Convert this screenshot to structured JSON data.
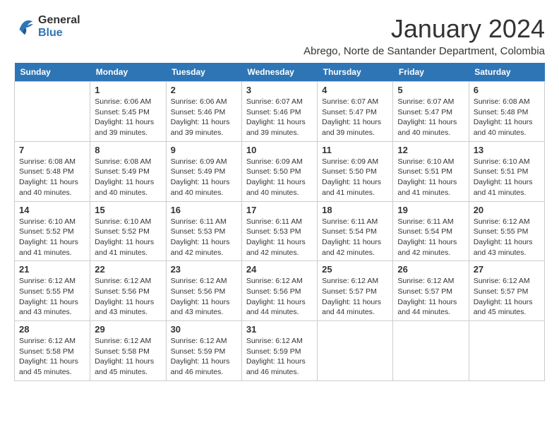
{
  "logo": {
    "text_general": "General",
    "text_blue": "Blue"
  },
  "header": {
    "title": "January 2024",
    "subtitle": "Abrego, Norte de Santander Department, Colombia"
  },
  "weekdays": [
    "Sunday",
    "Monday",
    "Tuesday",
    "Wednesday",
    "Thursday",
    "Friday",
    "Saturday"
  ],
  "weeks": [
    [
      {
        "day": "",
        "info": ""
      },
      {
        "day": "1",
        "info": "Sunrise: 6:06 AM\nSunset: 5:45 PM\nDaylight: 11 hours\nand 39 minutes."
      },
      {
        "day": "2",
        "info": "Sunrise: 6:06 AM\nSunset: 5:46 PM\nDaylight: 11 hours\nand 39 minutes."
      },
      {
        "day": "3",
        "info": "Sunrise: 6:07 AM\nSunset: 5:46 PM\nDaylight: 11 hours\nand 39 minutes."
      },
      {
        "day": "4",
        "info": "Sunrise: 6:07 AM\nSunset: 5:47 PM\nDaylight: 11 hours\nand 39 minutes."
      },
      {
        "day": "5",
        "info": "Sunrise: 6:07 AM\nSunset: 5:47 PM\nDaylight: 11 hours\nand 40 minutes."
      },
      {
        "day": "6",
        "info": "Sunrise: 6:08 AM\nSunset: 5:48 PM\nDaylight: 11 hours\nand 40 minutes."
      }
    ],
    [
      {
        "day": "7",
        "info": "Sunrise: 6:08 AM\nSunset: 5:48 PM\nDaylight: 11 hours\nand 40 minutes."
      },
      {
        "day": "8",
        "info": "Sunrise: 6:08 AM\nSunset: 5:49 PM\nDaylight: 11 hours\nand 40 minutes."
      },
      {
        "day": "9",
        "info": "Sunrise: 6:09 AM\nSunset: 5:49 PM\nDaylight: 11 hours\nand 40 minutes."
      },
      {
        "day": "10",
        "info": "Sunrise: 6:09 AM\nSunset: 5:50 PM\nDaylight: 11 hours\nand 40 minutes."
      },
      {
        "day": "11",
        "info": "Sunrise: 6:09 AM\nSunset: 5:50 PM\nDaylight: 11 hours\nand 41 minutes."
      },
      {
        "day": "12",
        "info": "Sunrise: 6:10 AM\nSunset: 5:51 PM\nDaylight: 11 hours\nand 41 minutes."
      },
      {
        "day": "13",
        "info": "Sunrise: 6:10 AM\nSunset: 5:51 PM\nDaylight: 11 hours\nand 41 minutes."
      }
    ],
    [
      {
        "day": "14",
        "info": "Sunrise: 6:10 AM\nSunset: 5:52 PM\nDaylight: 11 hours\nand 41 minutes."
      },
      {
        "day": "15",
        "info": "Sunrise: 6:10 AM\nSunset: 5:52 PM\nDaylight: 11 hours\nand 41 minutes."
      },
      {
        "day": "16",
        "info": "Sunrise: 6:11 AM\nSunset: 5:53 PM\nDaylight: 11 hours\nand 42 minutes."
      },
      {
        "day": "17",
        "info": "Sunrise: 6:11 AM\nSunset: 5:53 PM\nDaylight: 11 hours\nand 42 minutes."
      },
      {
        "day": "18",
        "info": "Sunrise: 6:11 AM\nSunset: 5:54 PM\nDaylight: 11 hours\nand 42 minutes."
      },
      {
        "day": "19",
        "info": "Sunrise: 6:11 AM\nSunset: 5:54 PM\nDaylight: 11 hours\nand 42 minutes."
      },
      {
        "day": "20",
        "info": "Sunrise: 6:12 AM\nSunset: 5:55 PM\nDaylight: 11 hours\nand 43 minutes."
      }
    ],
    [
      {
        "day": "21",
        "info": "Sunrise: 6:12 AM\nSunset: 5:55 PM\nDaylight: 11 hours\nand 43 minutes."
      },
      {
        "day": "22",
        "info": "Sunrise: 6:12 AM\nSunset: 5:56 PM\nDaylight: 11 hours\nand 43 minutes."
      },
      {
        "day": "23",
        "info": "Sunrise: 6:12 AM\nSunset: 5:56 PM\nDaylight: 11 hours\nand 43 minutes."
      },
      {
        "day": "24",
        "info": "Sunrise: 6:12 AM\nSunset: 5:56 PM\nDaylight: 11 hours\nand 44 minutes."
      },
      {
        "day": "25",
        "info": "Sunrise: 6:12 AM\nSunset: 5:57 PM\nDaylight: 11 hours\nand 44 minutes."
      },
      {
        "day": "26",
        "info": "Sunrise: 6:12 AM\nSunset: 5:57 PM\nDaylight: 11 hours\nand 44 minutes."
      },
      {
        "day": "27",
        "info": "Sunrise: 6:12 AM\nSunset: 5:57 PM\nDaylight: 11 hours\nand 45 minutes."
      }
    ],
    [
      {
        "day": "28",
        "info": "Sunrise: 6:12 AM\nSunset: 5:58 PM\nDaylight: 11 hours\nand 45 minutes."
      },
      {
        "day": "29",
        "info": "Sunrise: 6:12 AM\nSunset: 5:58 PM\nDaylight: 11 hours\nand 45 minutes."
      },
      {
        "day": "30",
        "info": "Sunrise: 6:12 AM\nSunset: 5:59 PM\nDaylight: 11 hours\nand 46 minutes."
      },
      {
        "day": "31",
        "info": "Sunrise: 6:12 AM\nSunset: 5:59 PM\nDaylight: 11 hours\nand 46 minutes."
      },
      {
        "day": "",
        "info": ""
      },
      {
        "day": "",
        "info": ""
      },
      {
        "day": "",
        "info": ""
      }
    ]
  ]
}
